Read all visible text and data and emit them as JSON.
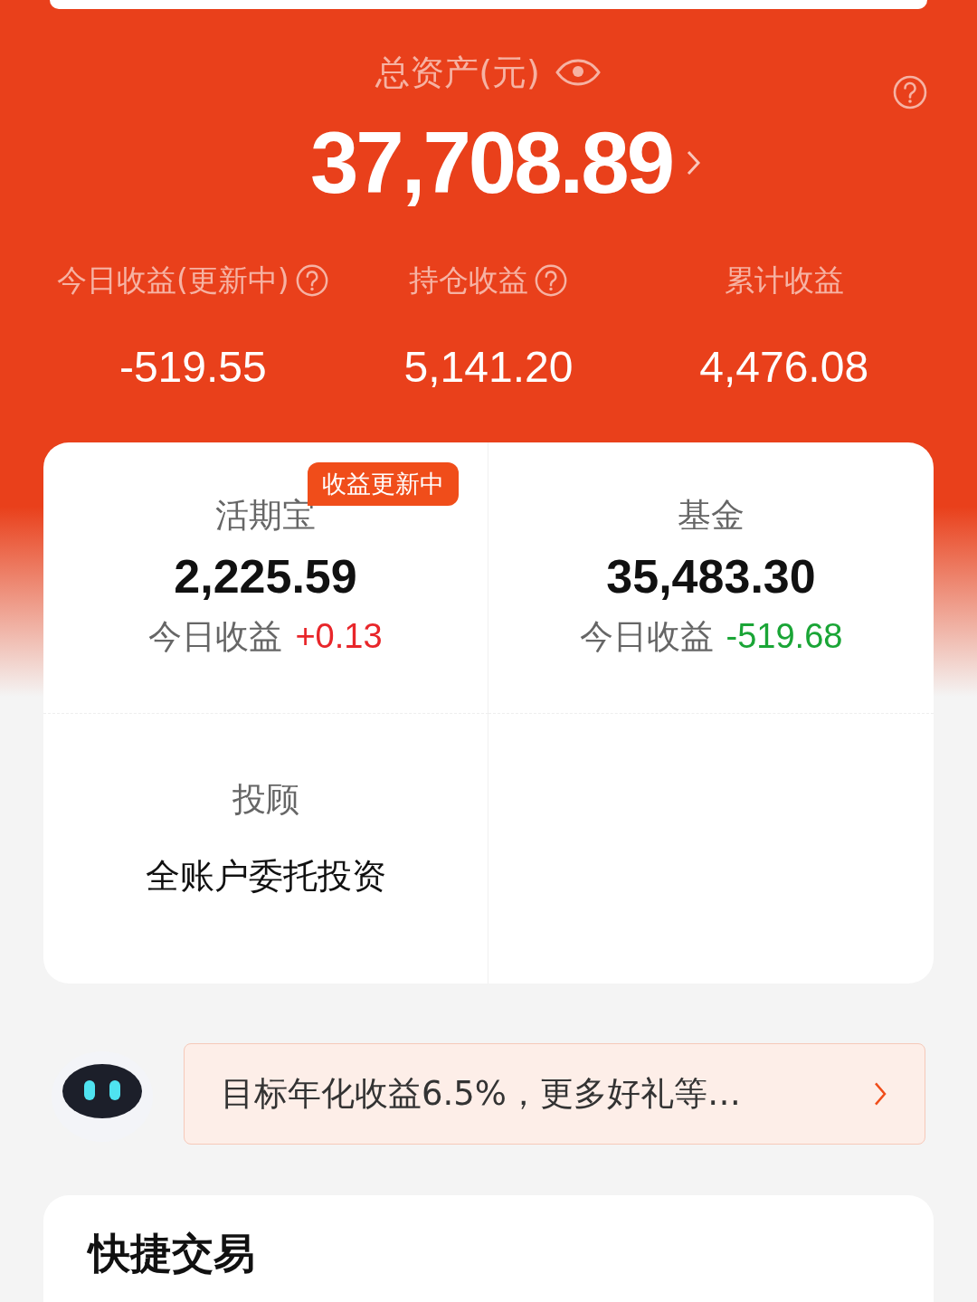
{
  "summary": {
    "title": "总资产(元)",
    "total": "37,708.89",
    "stats": [
      {
        "label": "今日收益(更新中)",
        "help": true,
        "value": "-519.55"
      },
      {
        "label": "持仓收益",
        "help": true,
        "value": "5,141.20"
      },
      {
        "label": "累计收益",
        "help": false,
        "value": "4,476.08"
      }
    ]
  },
  "assets": [
    {
      "kind": "balance",
      "name": "活期宝",
      "badge": "收益更新中",
      "amount": "2,225.59",
      "today_label": "今日收益",
      "today": "+0.13",
      "color": "#e8262a"
    },
    {
      "kind": "balance",
      "name": "基金",
      "amount": "35,483.30",
      "today_label": "今日收益",
      "today": "-519.68",
      "color": "#1aa536"
    },
    {
      "kind": "advisor",
      "name": "投顾",
      "subtitle": "全账户委托投资"
    }
  ],
  "assistant": {
    "message": "目标年化收益6.5%，更多好礼等…"
  },
  "quick_trade": {
    "title": "快捷交易"
  }
}
